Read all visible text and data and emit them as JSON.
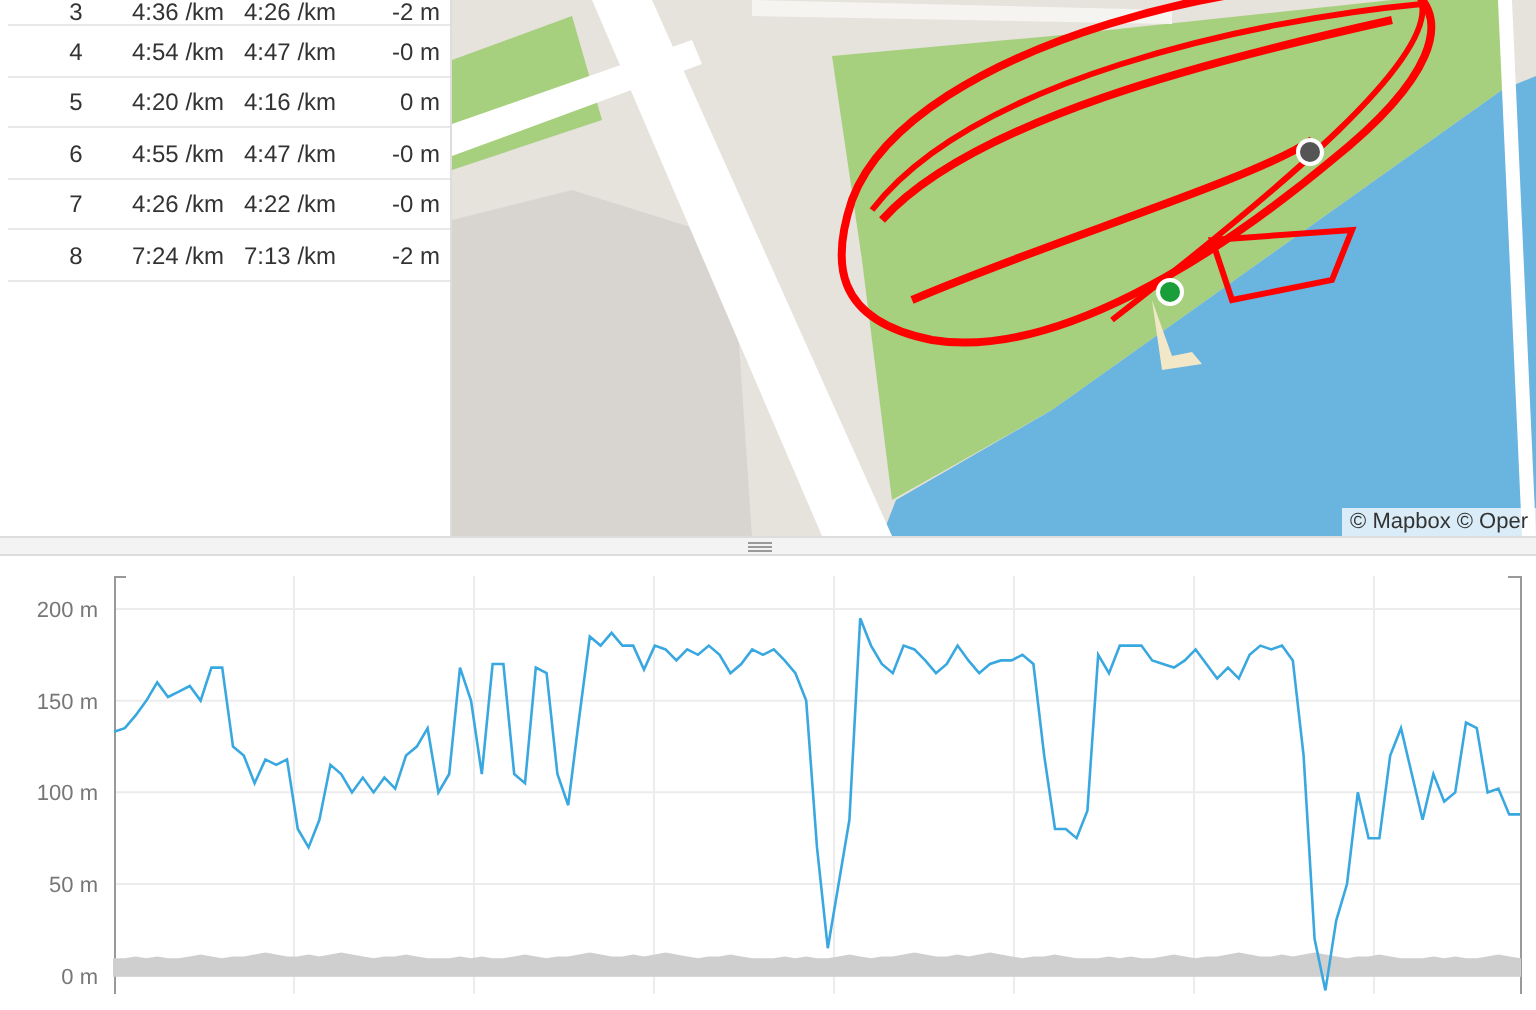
{
  "splits": {
    "rows": [
      {
        "column_1": "3",
        "column_2": "4:36 /km",
        "column_3": "4:26 /km",
        "column_4": "-2 m"
      },
      {
        "column_1": "4",
        "column_2": "4:54 /km",
        "column_3": "4:47 /km",
        "column_4": "-0 m"
      },
      {
        "column_1": "5",
        "column_2": "4:20 /km",
        "column_3": "4:16 /km",
        "column_4": "0 m"
      },
      {
        "column_1": "6",
        "column_2": "4:55 /km",
        "column_3": "4:47 /km",
        "column_4": "-0 m"
      },
      {
        "column_1": "7",
        "column_2": "4:26 /km",
        "column_3": "4:22 /km",
        "column_4": "-0 m"
      },
      {
        "column_1": "8",
        "column_2": "7:24 /km",
        "column_3": "7:13 /km",
        "column_4": "-2 m"
      }
    ]
  },
  "map": {
    "kind": "picture",
    "attribution": "© Mapbox © Oper"
  },
  "elevation": {
    "chart_data": {
      "type": "line",
      "grid": true,
      "ylim": [
        -10,
        218
      ],
      "yticks": [
        {
          "value": 0,
          "label": "0 m"
        },
        {
          "value": 50,
          "label": "50 m"
        },
        {
          "value": 100,
          "label": "100 m"
        },
        {
          "value": 150,
          "label": "150 m"
        },
        {
          "value": 200,
          "label": "200 m"
        }
      ],
      "series": [
        {
          "type": "area",
          "color": "#cfcfcf",
          "values": [
            9,
            9,
            10,
            9,
            10,
            9,
            9,
            10,
            11,
            10,
            9,
            10,
            10,
            11,
            12,
            11,
            10,
            10,
            11,
            10,
            11,
            12,
            11,
            10,
            9,
            10,
            10,
            11,
            10,
            9,
            9,
            9,
            10,
            9,
            10,
            9,
            9,
            10,
            11,
            10,
            9,
            10,
            10,
            11,
            12,
            11,
            10,
            10,
            11,
            10,
            11,
            12,
            11,
            10,
            9,
            10,
            10,
            11,
            10,
            9,
            9,
            9,
            10,
            9,
            10,
            9,
            9,
            10,
            11,
            10,
            9,
            10,
            10,
            11,
            12,
            11,
            10,
            10,
            11,
            10,
            11,
            12,
            11,
            10,
            9,
            10,
            10,
            11,
            10,
            9,
            9,
            9,
            10,
            9,
            10,
            9,
            9,
            10,
            11,
            10,
            9,
            10,
            10,
            11,
            12,
            11,
            10,
            10,
            11,
            10,
            11,
            12,
            11,
            10,
            9,
            10,
            10,
            11,
            10,
            9,
            9,
            9,
            10,
            9,
            10,
            9,
            9,
            10,
            11,
            10,
            9
          ]
        },
        {
          "type": "line",
          "color": "#3aa8e0",
          "values": [
            133,
            135,
            142,
            150,
            160,
            152,
            155,
            158,
            150,
            168,
            168,
            125,
            120,
            105,
            118,
            115,
            118,
            80,
            70,
            85,
            115,
            110,
            100,
            108,
            100,
            108,
            102,
            120,
            125,
            135,
            100,
            110,
            168,
            150,
            110,
            170,
            170,
            110,
            105,
            168,
            165,
            110,
            93,
            140,
            185,
            180,
            187,
            180,
            180,
            167,
            180,
            178,
            172,
            178,
            175,
            180,
            175,
            165,
            170,
            178,
            175,
            178,
            172,
            165,
            150,
            70,
            15,
            50,
            85,
            195,
            180,
            170,
            165,
            180,
            178,
            172,
            165,
            170,
            180,
            172,
            165,
            170,
            172,
            172,
            175,
            170,
            120,
            80,
            80,
            75,
            90,
            175,
            165,
            180,
            180,
            180,
            172,
            170,
            168,
            172,
            178,
            170,
            162,
            168,
            162,
            175,
            180,
            178,
            180,
            172,
            120,
            20,
            -8,
            30,
            50,
            100,
            75,
            75,
            120,
            135,
            110,
            85,
            110,
            95,
            100,
            138,
            135,
            100,
            102,
            88,
            88
          ]
        }
      ]
    }
  }
}
